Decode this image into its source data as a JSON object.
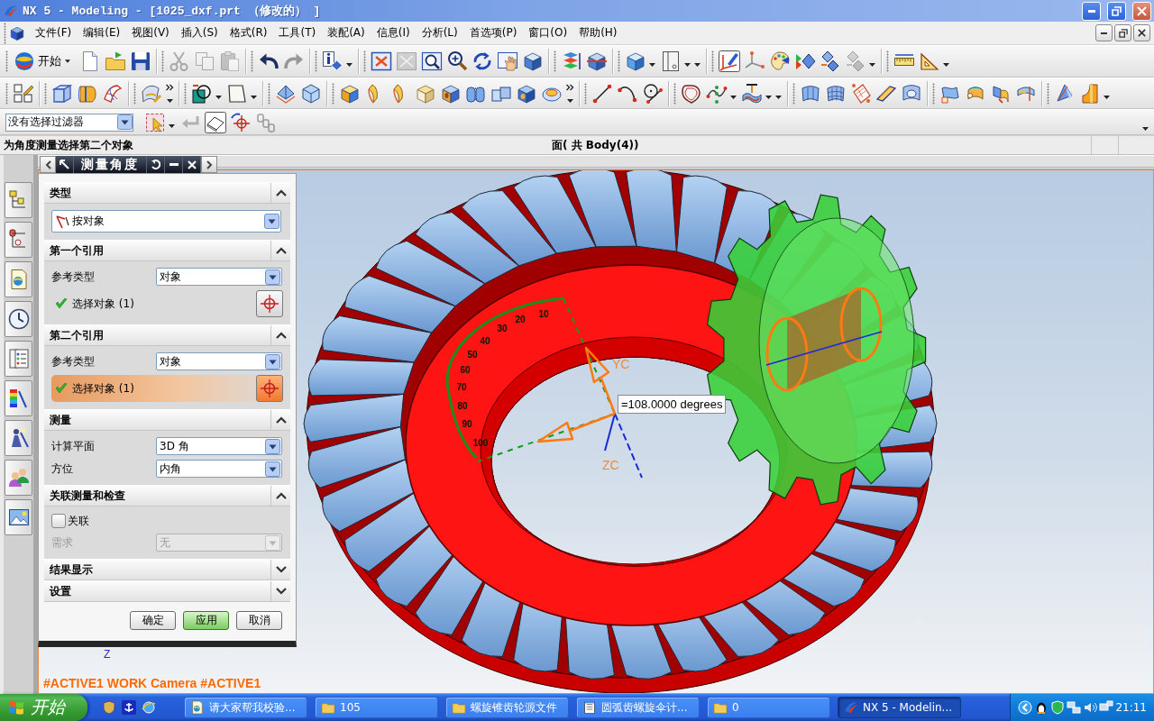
{
  "window": {
    "title": "NX 5 - Modeling - [1025_dxf.prt （修改的） ]"
  },
  "menu": [
    "文件(F)",
    "编辑(E)",
    "视图(V)",
    "插入(S)",
    "格式(R)",
    "工具(T)",
    "装配(A)",
    "信息(I)",
    "分析(L)",
    "首选项(P)",
    "窗口(O)",
    "帮助(H)"
  ],
  "toolbars": [
    {
      "groups": [
        [
          {
            "kind": "start",
            "label": "开始",
            "disabled": false,
            "selected": false
          },
          {
            "kind": "page",
            "disabled": false,
            "selected": false
          },
          {
            "kind": "folder",
            "disabled": false,
            "selected": false
          },
          {
            "kind": "floppy",
            "disabled": false,
            "selected": false
          }
        ],
        [
          {
            "kind": "scissors",
            "disabled": true,
            "selected": false
          },
          {
            "kind": "copy",
            "disabled": true,
            "selected": false
          },
          {
            "kind": "paste",
            "disabled": true,
            "selected": false
          }
        ],
        [
          {
            "kind": "undo",
            "disabled": false,
            "selected": false
          },
          {
            "kind": "redo",
            "disabled": true,
            "selected": false
          }
        ],
        [
          {
            "kind": "info",
            "disabled": false,
            "selected": false
          },
          {
            "kind": "caret",
            "disabled": false,
            "selected": false
          }
        ],
        [
          {
            "kind": "fit",
            "disabled": false,
            "selected": false
          },
          {
            "kind": "frame",
            "disabled": true,
            "selected": false
          },
          {
            "kind": "zoomwin",
            "disabled": false,
            "selected": false
          },
          {
            "kind": "zoom",
            "disabled": false,
            "selected": false
          },
          {
            "kind": "rotate",
            "disabled": false,
            "selected": false
          },
          {
            "kind": "hand",
            "disabled": false,
            "selected": false
          },
          {
            "kind": "block",
            "disabled": false,
            "selected": false
          }
        ],
        [
          {
            "kind": "layers",
            "disabled": false,
            "selected": false
          },
          {
            "kind": "cubes",
            "disabled": false,
            "selected": false
          }
        ],
        [
          {
            "kind": "cube",
            "disabled": false,
            "selected": false
          },
          {
            "kind": "caret",
            "disabled": false,
            "selected": false
          },
          {
            "kind": "panel",
            "disabled": false,
            "selected": false
          },
          {
            "kind": "caret",
            "disabled": false,
            "selected": false
          },
          {
            "kind": "caret",
            "disabled": false,
            "selected": false
          }
        ],
        [
          {
            "kind": "wcs",
            "disabled": false,
            "selected": true
          },
          {
            "kind": "axes",
            "disabled": false,
            "selected": false
          },
          {
            "kind": "palette",
            "disabled": false,
            "selected": false
          },
          {
            "kind": "arrows",
            "disabled": false,
            "selected": false
          },
          {
            "kind": "diamonds",
            "disabled": false,
            "selected": false
          },
          {
            "kind": "diamonds",
            "disabled": true,
            "selected": false
          },
          {
            "kind": "caret",
            "disabled": false,
            "selected": false
          }
        ],
        [
          {
            "kind": "ruler",
            "disabled": false,
            "selected": false
          },
          {
            "kind": "protractor",
            "disabled": false,
            "selected": false
          },
          {
            "kind": "caret",
            "disabled": false,
            "selected": false
          }
        ]
      ]
    },
    {
      "groups": [
        [
          {
            "kind": "sketch",
            "disabled": false,
            "selected": false
          }
        ],
        [
          {
            "kind": "extrude",
            "disabled": false,
            "selected": false
          },
          {
            "kind": "revolve",
            "disabled": false,
            "selected": false
          },
          {
            "kind": "sweep",
            "disabled": false,
            "selected": false
          }
        ],
        [
          {
            "kind": "blend",
            "disabled": false,
            "selected": false
          },
          {
            "kind": "more",
            "disabled": false,
            "selected": false
          }
        ],
        [
          {
            "kind": "datum",
            "disabled": false,
            "selected": false
          },
          {
            "kind": "caret",
            "disabled": false,
            "selected": false
          },
          {
            "kind": "plane",
            "disabled": false,
            "selected": false
          },
          {
            "kind": "caret",
            "disabled": false,
            "selected": false
          }
        ],
        [
          {
            "kind": "pyramid",
            "disabled": false,
            "selected": false
          },
          {
            "kind": "poly",
            "disabled": false,
            "selected": false
          }
        ],
        [
          {
            "kind": "box",
            "disabled": false,
            "selected": false
          },
          {
            "kind": "sheet",
            "disabled": false,
            "selected": false
          },
          {
            "kind": "sheet",
            "disabled": false,
            "selected": false
          },
          {
            "kind": "tablet",
            "disabled": false,
            "selected": false
          },
          {
            "kind": "hole",
            "disabled": false,
            "selected": false
          },
          {
            "kind": "cylinders",
            "disabled": false,
            "selected": false
          },
          {
            "kind": "blocks",
            "disabled": false,
            "selected": false
          },
          {
            "kind": "boss",
            "disabled": false,
            "selected": false
          },
          {
            "kind": "disc",
            "disabled": false,
            "selected": false
          },
          {
            "kind": "more",
            "disabled": false,
            "selected": false
          }
        ],
        [
          {
            "kind": "line",
            "disabled": false,
            "selected": false
          },
          {
            "kind": "arc",
            "disabled": false,
            "selected": false
          },
          {
            "kind": "circle",
            "disabled": false,
            "selected": false
          }
        ],
        [
          {
            "kind": "outline",
            "disabled": false,
            "selected": false
          },
          {
            "kind": "spline",
            "disabled": false,
            "selected": false
          },
          {
            "kind": "caret",
            "disabled": false,
            "selected": false
          },
          {
            "kind": "imprint",
            "disabled": false,
            "selected": false
          },
          {
            "kind": "caret",
            "disabled": false,
            "selected": false
          },
          {
            "kind": "caret",
            "disabled": false,
            "selected": false
          }
        ],
        [
          {
            "kind": "surface",
            "disabled": false,
            "selected": false
          },
          {
            "kind": "mesh",
            "disabled": false,
            "selected": false
          },
          {
            "kind": "patch",
            "disabled": false,
            "selected": false
          },
          {
            "kind": "tube",
            "disabled": false,
            "selected": false
          },
          {
            "kind": "trimmed",
            "disabled": false,
            "selected": false
          }
        ],
        [
          {
            "kind": "flag",
            "disabled": false,
            "selected": false
          },
          {
            "kind": "roller",
            "disabled": false,
            "selected": false
          },
          {
            "kind": "split",
            "disabled": false,
            "selected": false
          },
          {
            "kind": "bridge",
            "disabled": false,
            "selected": false
          }
        ],
        [
          {
            "kind": "shell",
            "disabled": false,
            "selected": false
          },
          {
            "kind": "draft",
            "disabled": false,
            "selected": false
          },
          {
            "kind": "caret",
            "disabled": false,
            "selected": false
          }
        ]
      ]
    }
  ],
  "selection_bar": {
    "filter": "没有选择过滤器",
    "tools": [
      {
        "kind": "filter",
        "disabled": false,
        "selected": false
      },
      {
        "kind": "caret",
        "disabled": false,
        "selected": false
      },
      {
        "kind": "back",
        "disabled": true,
        "selected": false
      },
      {
        "kind": "eraser",
        "disabled": false,
        "selected": true
      },
      {
        "kind": "snap",
        "disabled": false,
        "selected": false
      },
      {
        "kind": "chain",
        "disabled": true,
        "selected": false
      }
    ]
  },
  "cue_line": {
    "prompt": "为角度测量选择第二个对象",
    "status": "面( 共 Body(4))"
  },
  "resource_tabs": [
    {
      "kind": "assembly",
      "selected": false
    },
    {
      "kind": "partnav",
      "selected": false
    },
    {
      "kind": "browser",
      "selected": false
    },
    {
      "kind": "history",
      "selected": false
    },
    {
      "kind": "list",
      "selected": false
    },
    {
      "kind": "spectrum",
      "selected": false
    },
    {
      "kind": "figure",
      "selected": false
    },
    {
      "kind": "roles",
      "selected": false
    },
    {
      "kind": "images",
      "selected": false
    }
  ],
  "dialog": {
    "title": "测量角度",
    "sections": [
      {
        "title": "类型",
        "expanded": true,
        "rows": [
          {
            "kind": "typepicker",
            "value": "按对象",
            "disabled": false
          }
        ]
      },
      {
        "title": "第一个引用",
        "expanded": true,
        "rows": [
          {
            "kind": "dropdown",
            "label": "参考类型",
            "value": "对象",
            "disabled": false
          },
          {
            "kind": "selection",
            "label": "选择对象 (1)",
            "complete": true,
            "selected": false
          }
        ]
      },
      {
        "title": "第二个引用",
        "expanded": true,
        "rows": [
          {
            "kind": "dropdown",
            "label": "参考类型",
            "value": "对象",
            "disabled": false
          },
          {
            "kind": "selection",
            "label": "选择对象 (1)",
            "complete": true,
            "selected": true
          }
        ]
      },
      {
        "title": "测量",
        "expanded": true,
        "rows": [
          {
            "kind": "dropdown",
            "label": "计算平面",
            "value": "3D 角",
            "disabled": false
          },
          {
            "kind": "dropdown",
            "label": "方位",
            "value": "内角",
            "disabled": false
          }
        ]
      },
      {
        "title": "关联测量和检查",
        "expanded": true,
        "rows": [
          {
            "kind": "checkbox",
            "label": "关联",
            "checked": false
          },
          {
            "kind": "dropdown",
            "label": "需求",
            "value": "无",
            "disabled": true
          }
        ]
      },
      {
        "title": "结果显示",
        "expanded": false
      },
      {
        "title": "设置",
        "expanded": false
      }
    ],
    "buttons": [
      {
        "label": "确定",
        "default": false
      },
      {
        "label": "应用",
        "default": true
      },
      {
        "label": "取消",
        "default": false
      }
    ]
  },
  "viewport": {
    "measurement": "=108.0000 degrees",
    "scale_labels": [
      "10",
      "20",
      "30",
      "40",
      "50",
      "60",
      "70",
      "80",
      "90",
      "100"
    ],
    "axis_labels": [
      "YC",
      "ZC"
    ],
    "triad_label": "Z",
    "camera_status": "#ACTIVE1 WORK Camera #ACTIVE1"
  },
  "taskbar": {
    "start": "开始",
    "tasks": [
      {
        "kind": "browser",
        "label": "请大家帮我校验...",
        "selected": false
      },
      {
        "kind": "folder",
        "label": "105",
        "selected": false
      },
      {
        "kind": "folder",
        "label": "螺旋锥齿轮源文件",
        "selected": false
      },
      {
        "kind": "notepad",
        "label": "圆弧齿螺旋伞计...",
        "selected": false
      },
      {
        "kind": "folder",
        "label": "0",
        "selected": false
      },
      {
        "kind": "logo",
        "label": "NX 5 - Modelin...",
        "selected": true
      }
    ],
    "clock": "21:11"
  }
}
